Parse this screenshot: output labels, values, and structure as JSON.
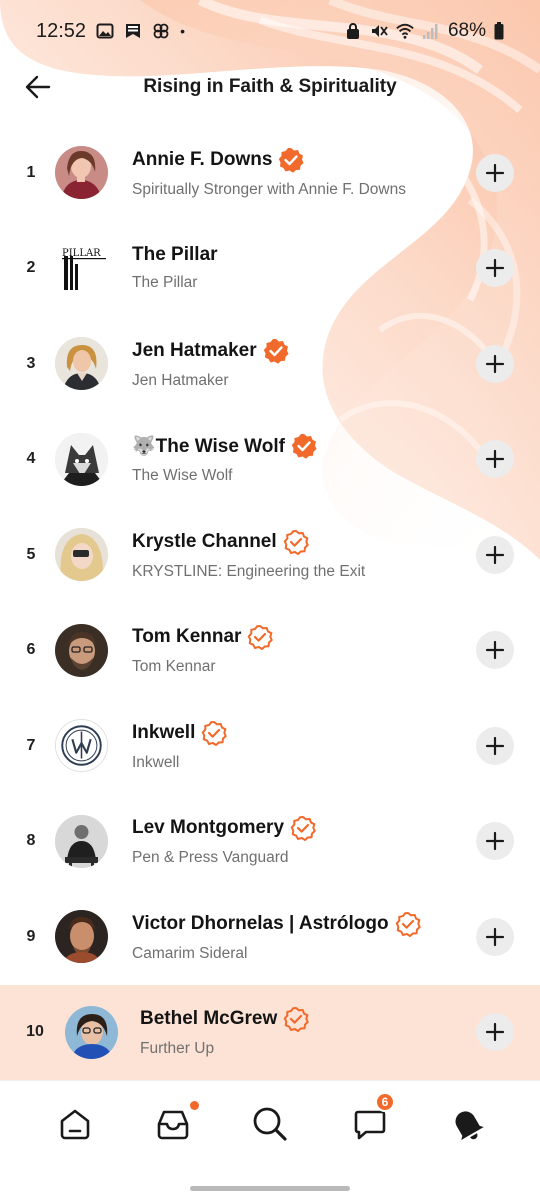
{
  "status_bar": {
    "time": "12:52",
    "dot": "•",
    "battery": "68%",
    "icons_left": [
      "image-icon",
      "bookmark-icon",
      "pinwheel-icon"
    ],
    "icons_right": [
      "lock-icon",
      "mute-icon",
      "wifi-icon",
      "signal-icon",
      "battery-icon"
    ]
  },
  "header": {
    "title": "Rising in Faith & Spirituality",
    "back_icon": "arrow-left-icon"
  },
  "colors": {
    "accent": "#f26a2b",
    "highlight_row": "#fde3d6",
    "add_button_bg": "#ececec"
  },
  "rows": [
    {
      "rank": "1",
      "name": "Annie F. Downs",
      "subtitle": "Spiritually Stronger with Annie F. Downs",
      "verified_style": "filled"
    },
    {
      "rank": "2",
      "name": "The Pillar",
      "subtitle": "The Pillar",
      "verified_style": "none",
      "logo_text": "PILLAR"
    },
    {
      "rank": "3",
      "name": "Jen Hatmaker",
      "subtitle": "Jen Hatmaker",
      "verified_style": "filled"
    },
    {
      "rank": "4",
      "name": "🐺The Wise Wolf",
      "subtitle": "The Wise Wolf",
      "verified_style": "filled"
    },
    {
      "rank": "5",
      "name": "Krystle Channel",
      "subtitle": "KRYSTLINE: Engineering the Exit",
      "verified_style": "outline"
    },
    {
      "rank": "6",
      "name": "Tom Kennar",
      "subtitle": "Tom Kennar",
      "verified_style": "outline"
    },
    {
      "rank": "7",
      "name": "Inkwell",
      "subtitle": "Inkwell",
      "verified_style": "outline"
    },
    {
      "rank": "8",
      "name": "Lev Montgomery",
      "subtitle": "Pen & Press Vanguard",
      "verified_style": "outline"
    },
    {
      "rank": "9",
      "name": "Victor Dhornelas | Astrólogo",
      "subtitle": "Camarim Sideral",
      "verified_style": "outline"
    },
    {
      "rank": "10",
      "name": "Bethel McGrew",
      "subtitle": "Further Up",
      "verified_style": "outline",
      "highlighted": true
    }
  ],
  "bottom_nav": {
    "items": [
      "home-icon",
      "inbox-icon",
      "search-icon",
      "chat-icon",
      "bell-icon"
    ],
    "inbox_dot": true,
    "chat_count": "6"
  }
}
